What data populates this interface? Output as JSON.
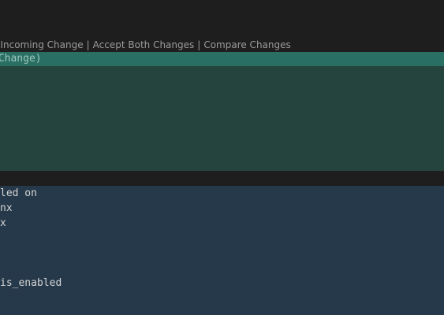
{
  "codelens": {
    "accept_incoming": "t Incoming Change",
    "accept_both": "Accept Both Changes",
    "compare": "Compare Changes",
    "separator": "|"
  },
  "incoming_marker": {
    "text": " Change)"
  },
  "code": {
    "lines": [
      "led on",
      "nx",
      "x",
      "",
      "",
      "is_enabled"
    ]
  }
}
